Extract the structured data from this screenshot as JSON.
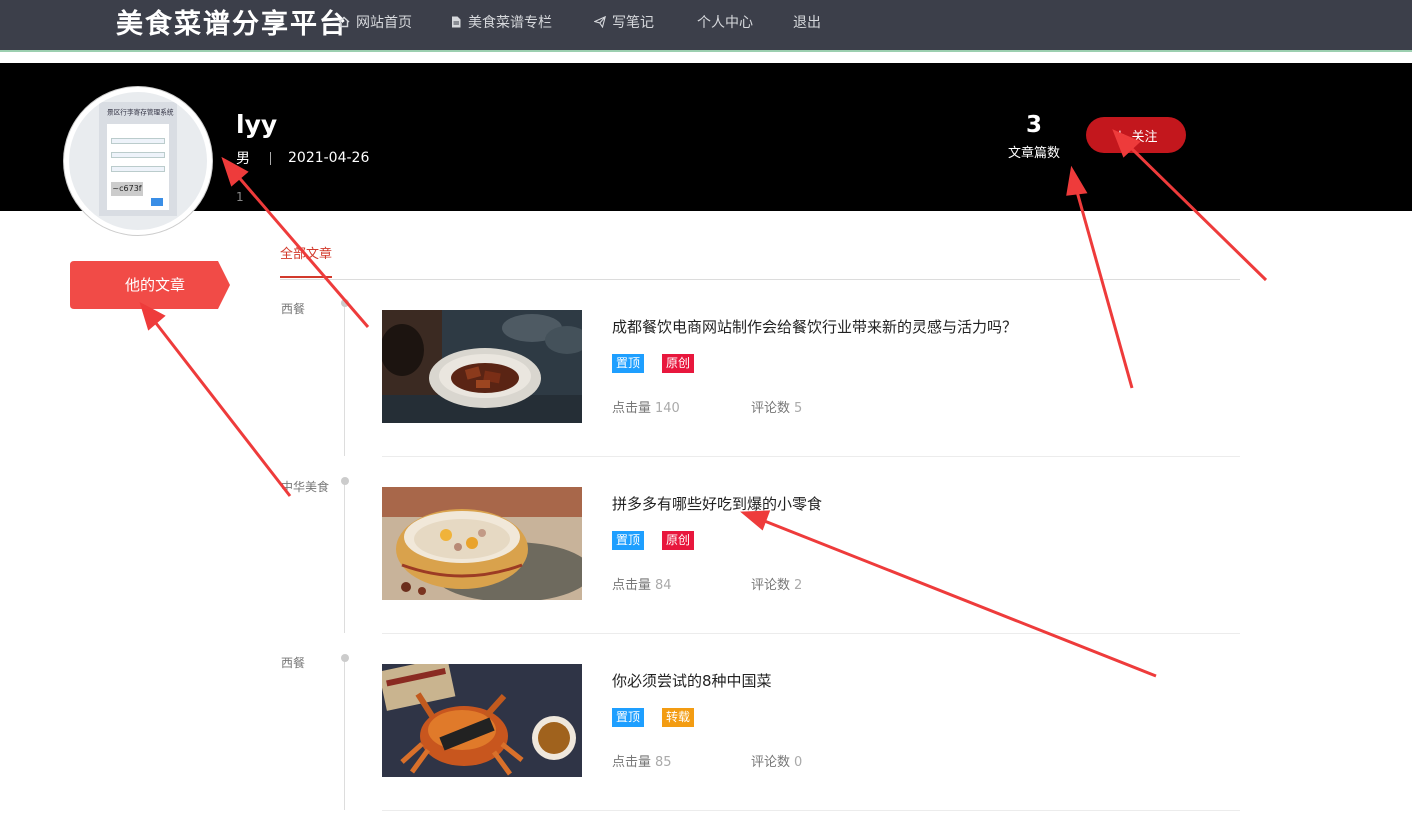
{
  "nav": {
    "brand": "美食菜谱分享平台",
    "items": [
      {
        "label": "网站首页",
        "icon": "home-icon"
      },
      {
        "label": "美食菜谱专栏",
        "icon": "document-icon"
      },
      {
        "label": "写笔记",
        "icon": "send-icon"
      },
      {
        "label": "个人中心",
        "icon": ""
      },
      {
        "label": "退出",
        "icon": ""
      }
    ]
  },
  "profile": {
    "avatar_caption": "景区行李寄存管理系统",
    "avatar_captcha": "~c673f",
    "name": "lyy",
    "gender": "男",
    "date": "2021-04-26",
    "extra": "1",
    "article_count": "3",
    "article_count_label": "文章篇数",
    "follow_label": "关注"
  },
  "sidebar": {
    "tab_label": "他的文章"
  },
  "tabs": {
    "active": "全部文章"
  },
  "articles": [
    {
      "category": "西餐",
      "title": "成都餐饮电商网站制作会给餐饮行业带来新的灵感与活力吗？",
      "tags": [
        "置顶",
        "原创"
      ],
      "clicks_label": "点击量",
      "clicks": "140",
      "comments_label": "评论数",
      "comments": "5"
    },
    {
      "category": "中华美食",
      "title": "拼多多有哪些好吃到爆的小零食",
      "tags": [
        "置顶",
        "原创"
      ],
      "clicks_label": "点击量",
      "clicks": "84",
      "comments_label": "评论数",
      "comments": "2"
    },
    {
      "category": "西餐",
      "title": "你必须尝试的8种中国菜",
      "tags": [
        "置顶",
        "转载"
      ],
      "clicks_label": "点击量",
      "clicks": "85",
      "comments_label": "评论数",
      "comments": "0"
    }
  ],
  "colors": {
    "nav_bg": "#3c3f4a",
    "accent_red": "#c3171d",
    "tab_red": "#d23a2c",
    "tag_blue": "#1e9fff",
    "tag_red": "#e8173d",
    "tag_orange": "#f39c12",
    "arrow": "#ee3b3b"
  }
}
